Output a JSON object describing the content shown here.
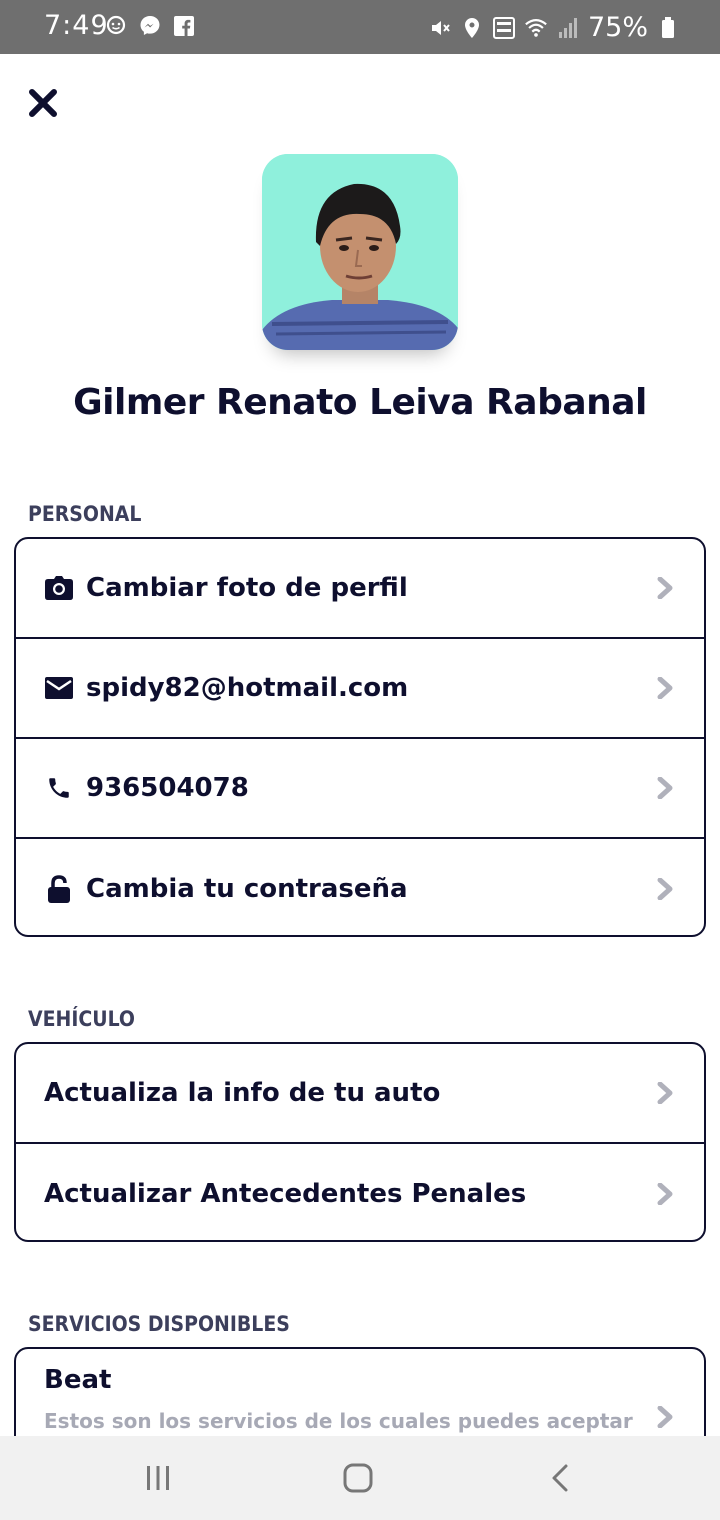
{
  "status_bar": {
    "time": "7:49",
    "battery": "75%",
    "left_icons": [
      "waze-icon",
      "messenger-icon",
      "facebook-icon"
    ],
    "right_icons": [
      "mute-icon",
      "location-icon",
      "volte-icon",
      "wifi-icon",
      "signal-icon",
      "battery-icon"
    ]
  },
  "profile": {
    "name": "Gilmer Renato Leiva Rabanal"
  },
  "personal": {
    "title": "PERSONAL",
    "items": [
      {
        "icon": "camera-icon",
        "label": "Cambiar foto de perfil"
      },
      {
        "icon": "mail-icon",
        "label": "spidy82@hotmail.com"
      },
      {
        "icon": "phone-icon",
        "label": "936504078"
      },
      {
        "icon": "lock-icon",
        "label": "Cambia tu contraseña"
      }
    ]
  },
  "vehicle": {
    "title": "VEHÍCULO",
    "items": [
      {
        "label": "Actualiza la info de tu auto"
      },
      {
        "label": "Actualizar Antecedentes Penales"
      }
    ]
  },
  "services": {
    "title": "SERVICIOS DISPONIBLES",
    "items": [
      {
        "title": "Beat",
        "description": "Estos son los servicios de los cuales puedes aceptar"
      }
    ]
  },
  "colors": {
    "text_dark": "#0e0f2e",
    "section_title": "#3c3f5c",
    "muted": "#a7a9b5",
    "chevron": "#b0b1bb",
    "status_bar": "#6f6f6f",
    "avatar_bg": "#8ff0dc"
  }
}
